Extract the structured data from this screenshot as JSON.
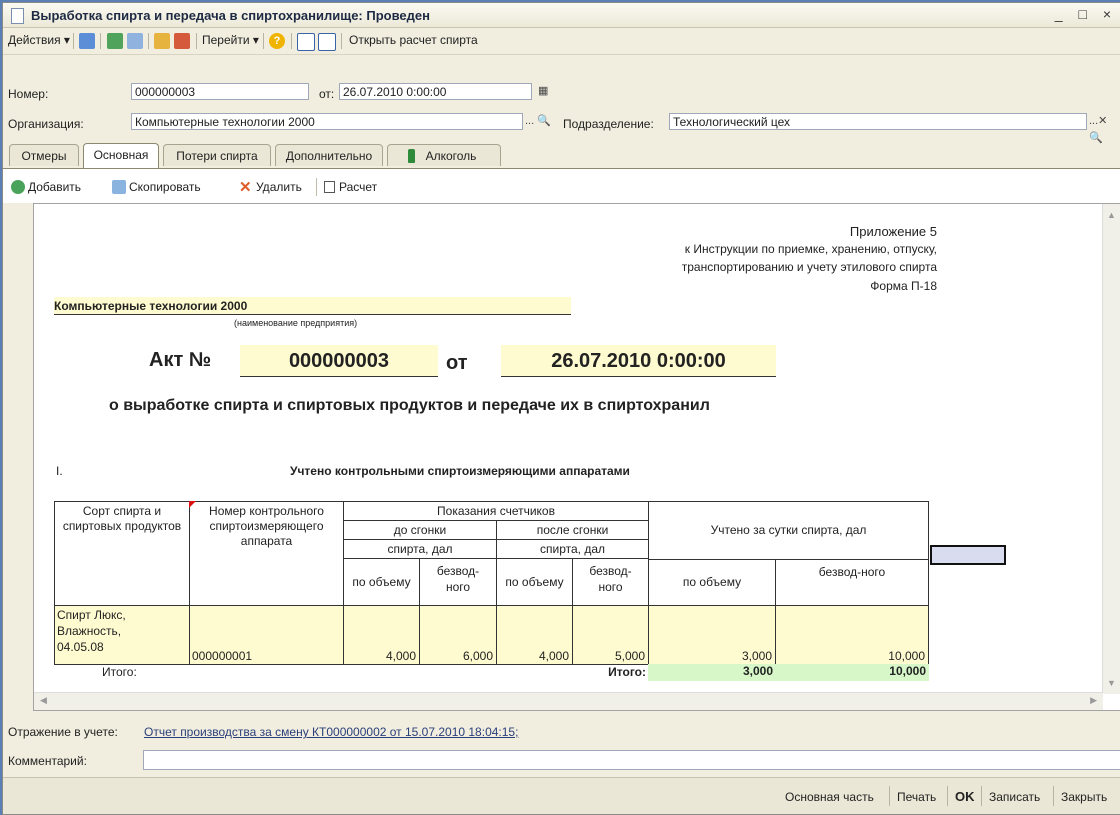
{
  "window": {
    "title": "Выработка спирта и передача в спиртохранилище: Проведен",
    "controls": "_ □ ×"
  },
  "toolbar": {
    "actions": "Действия ▾",
    "goto": "Перейти ▾",
    "open_calc": "Открыть расчет спирта"
  },
  "header": {
    "number_label": "Номер:",
    "number_value": "000000003",
    "date_label": "от:",
    "date_value": "26.07.2010  0:00:00",
    "org_label": "Организация:",
    "org_value": "Компьютерные технологии 2000",
    "dept_label": "Подразделение:",
    "dept_value": "Технологический цех"
  },
  "tabs": [
    {
      "label": "Отмеры"
    },
    {
      "label": "Основная"
    },
    {
      "label": "Потери спирта"
    },
    {
      "label": "Дополнительно"
    },
    {
      "label": "Алкоголь"
    }
  ],
  "subtoolbar": {
    "add": "Добавить",
    "copy": "Скопировать",
    "delete": "Удалить",
    "calc": "Расчет"
  },
  "report": {
    "appendix": "Приложение 5",
    "instr1": "к Инструкции по приемке, хранению, отпуску,",
    "instr2": "транспортированию и учету этилового спирта",
    "form": "Форма П-18",
    "org_name": "Компьютерные технологии 2000",
    "org_caption": "(наименование предприятия)",
    "act_label": "Акт №",
    "act_number": "000000003",
    "from_label": "от",
    "act_date": "26.07.2010 0:00:00",
    "subject": "о выработке спирта и спиртовых продуктов и передаче их в спиртохранил",
    "section_num": "I.",
    "section_title": "Учтено контрольными спиртоизмеряющими аппаратами",
    "table": {
      "h_sort": "Сорт спирта и спиртовых продуктов",
      "h_meter": "Номер контрольного спиртоизмеряющего аппарата",
      "h_readings": "Показания счетчиков",
      "h_before": "до сгонки",
      "h_after": "после сгонки",
      "h_spirit_dal": "спирта, дал",
      "h_spirit_dal2": "спирта, дал",
      "h_day": "Учтено за сутки спирта, дал",
      "h_volume": "по объему",
      "h_anhydrous": "безвод-ного",
      "h_volume2": "по объему",
      "h_anhydrous2": "безвод-ного",
      "h_volume3": "по объему",
      "h_anhydrous3": "безвод-ного",
      "row_sort_1": "Спирт Люкс,",
      "row_sort_2": "Влажность,",
      "row_sort_3": "04.05.08",
      "row_meter": "000000001",
      "row_b_vol": "4,000",
      "row_b_anh": "6,000",
      "row_a_vol": "4,000",
      "row_a_anh": "5,000",
      "row_d_vol": "3,000",
      "row_d_anh": "10,000",
      "total_label_left": "Итого:",
      "total_label": "Итого:",
      "total_vol": "3,000",
      "total_anh": "10,000"
    }
  },
  "footer": {
    "reflect_label": "Отражение в учете:",
    "reflect_link": "Отчет производства за смену КТ000000002 от 15.07.2010 18:04:15;",
    "comment_label": "Комментарий:",
    "comment_value": ""
  },
  "statusbar": {
    "main_part": "Основная часть",
    "print": "Печать",
    "ok": "OK",
    "save": "Записать",
    "close": "Закрыть"
  },
  "colors": {
    "highlight_yellow": "#fffbd0",
    "highlight_green": "#d7f7c8",
    "title_text": "#1e2a44"
  }
}
